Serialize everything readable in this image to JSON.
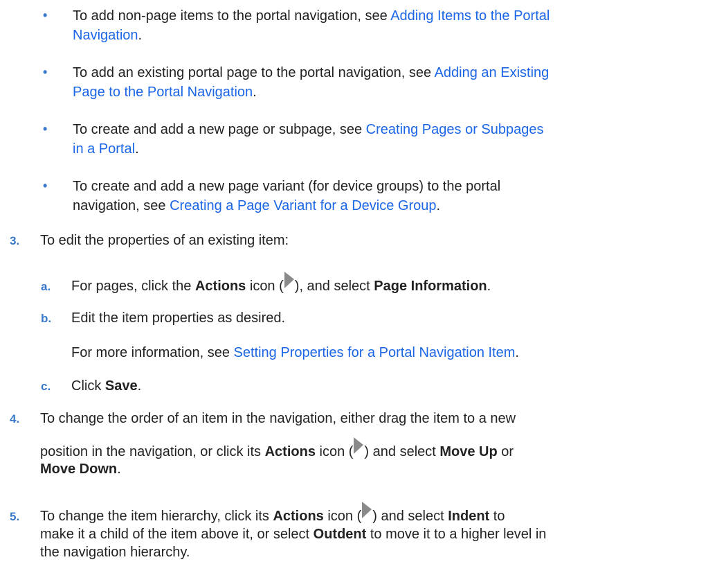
{
  "bullets": [
    {
      "pre": "To add non-page items to the portal navigation, see ",
      "link_a": "Adding Items to the Portal",
      "link_b": "Navigation",
      "post": "."
    },
    {
      "pre": "To add an existing portal page to the portal navigation, see ",
      "link_a": "Adding an Existing",
      "link_b": "Page to the Portal Navigation",
      "post": "."
    },
    {
      "pre": "To create and add a new page or subpage, see ",
      "link_a": "Creating Pages or Subpages",
      "link_b": "in a Portal",
      "post": "."
    },
    {
      "line1": "To create and add a new page variant (for device groups) to the portal",
      "pre": "navigation, see ",
      "link": "Creating a Page Variant for a Device Group",
      "post": "."
    }
  ],
  "bullet_glyph": "•",
  "step3": {
    "num": "3.",
    "text": "To edit the properties of an existing item:",
    "a": {
      "letter": "a.",
      "t1": "For pages, click the ",
      "b1": "Actions",
      "t2": " icon (",
      "t3": "), and select ",
      "b2": "Page Information",
      "t4": "."
    },
    "b": {
      "letter": "b.",
      "text": "Edit the item properties as desired."
    },
    "b_note": {
      "pre": "For more information, see ",
      "link": "Setting Properties for a Portal Navigation Item",
      "post": "."
    },
    "c": {
      "letter": "c.",
      "t1": "Click ",
      "b1": "Save",
      "t2": "."
    }
  },
  "step4": {
    "num": "4.",
    "line1": "To change the order of an item in the navigation, either drag the item to a new",
    "t1": "position in the navigation, or click its ",
    "b1": "Actions",
    "t2": " icon (",
    "t3": ") and select ",
    "b2": "Move Up",
    "t4": " or",
    "b3": "Move Down",
    "t5": "."
  },
  "step5": {
    "num": "5.",
    "t1": "To change the item hierarchy, click its ",
    "b1": "Actions",
    "t2": " icon (",
    "t3": ") and select ",
    "b2": "Indent",
    "t4": " to",
    "line2a": "make it a child of the item above it, or select ",
    "b3": "Outdent",
    "line2b": " to move it to a higher level in",
    "line3": "the navigation hierarchy."
  },
  "icons": {
    "actions": "actions-arrow-icon"
  },
  "colors": {
    "link": "#1a66e6",
    "marker": "#3a78c9",
    "text": "#222222"
  }
}
